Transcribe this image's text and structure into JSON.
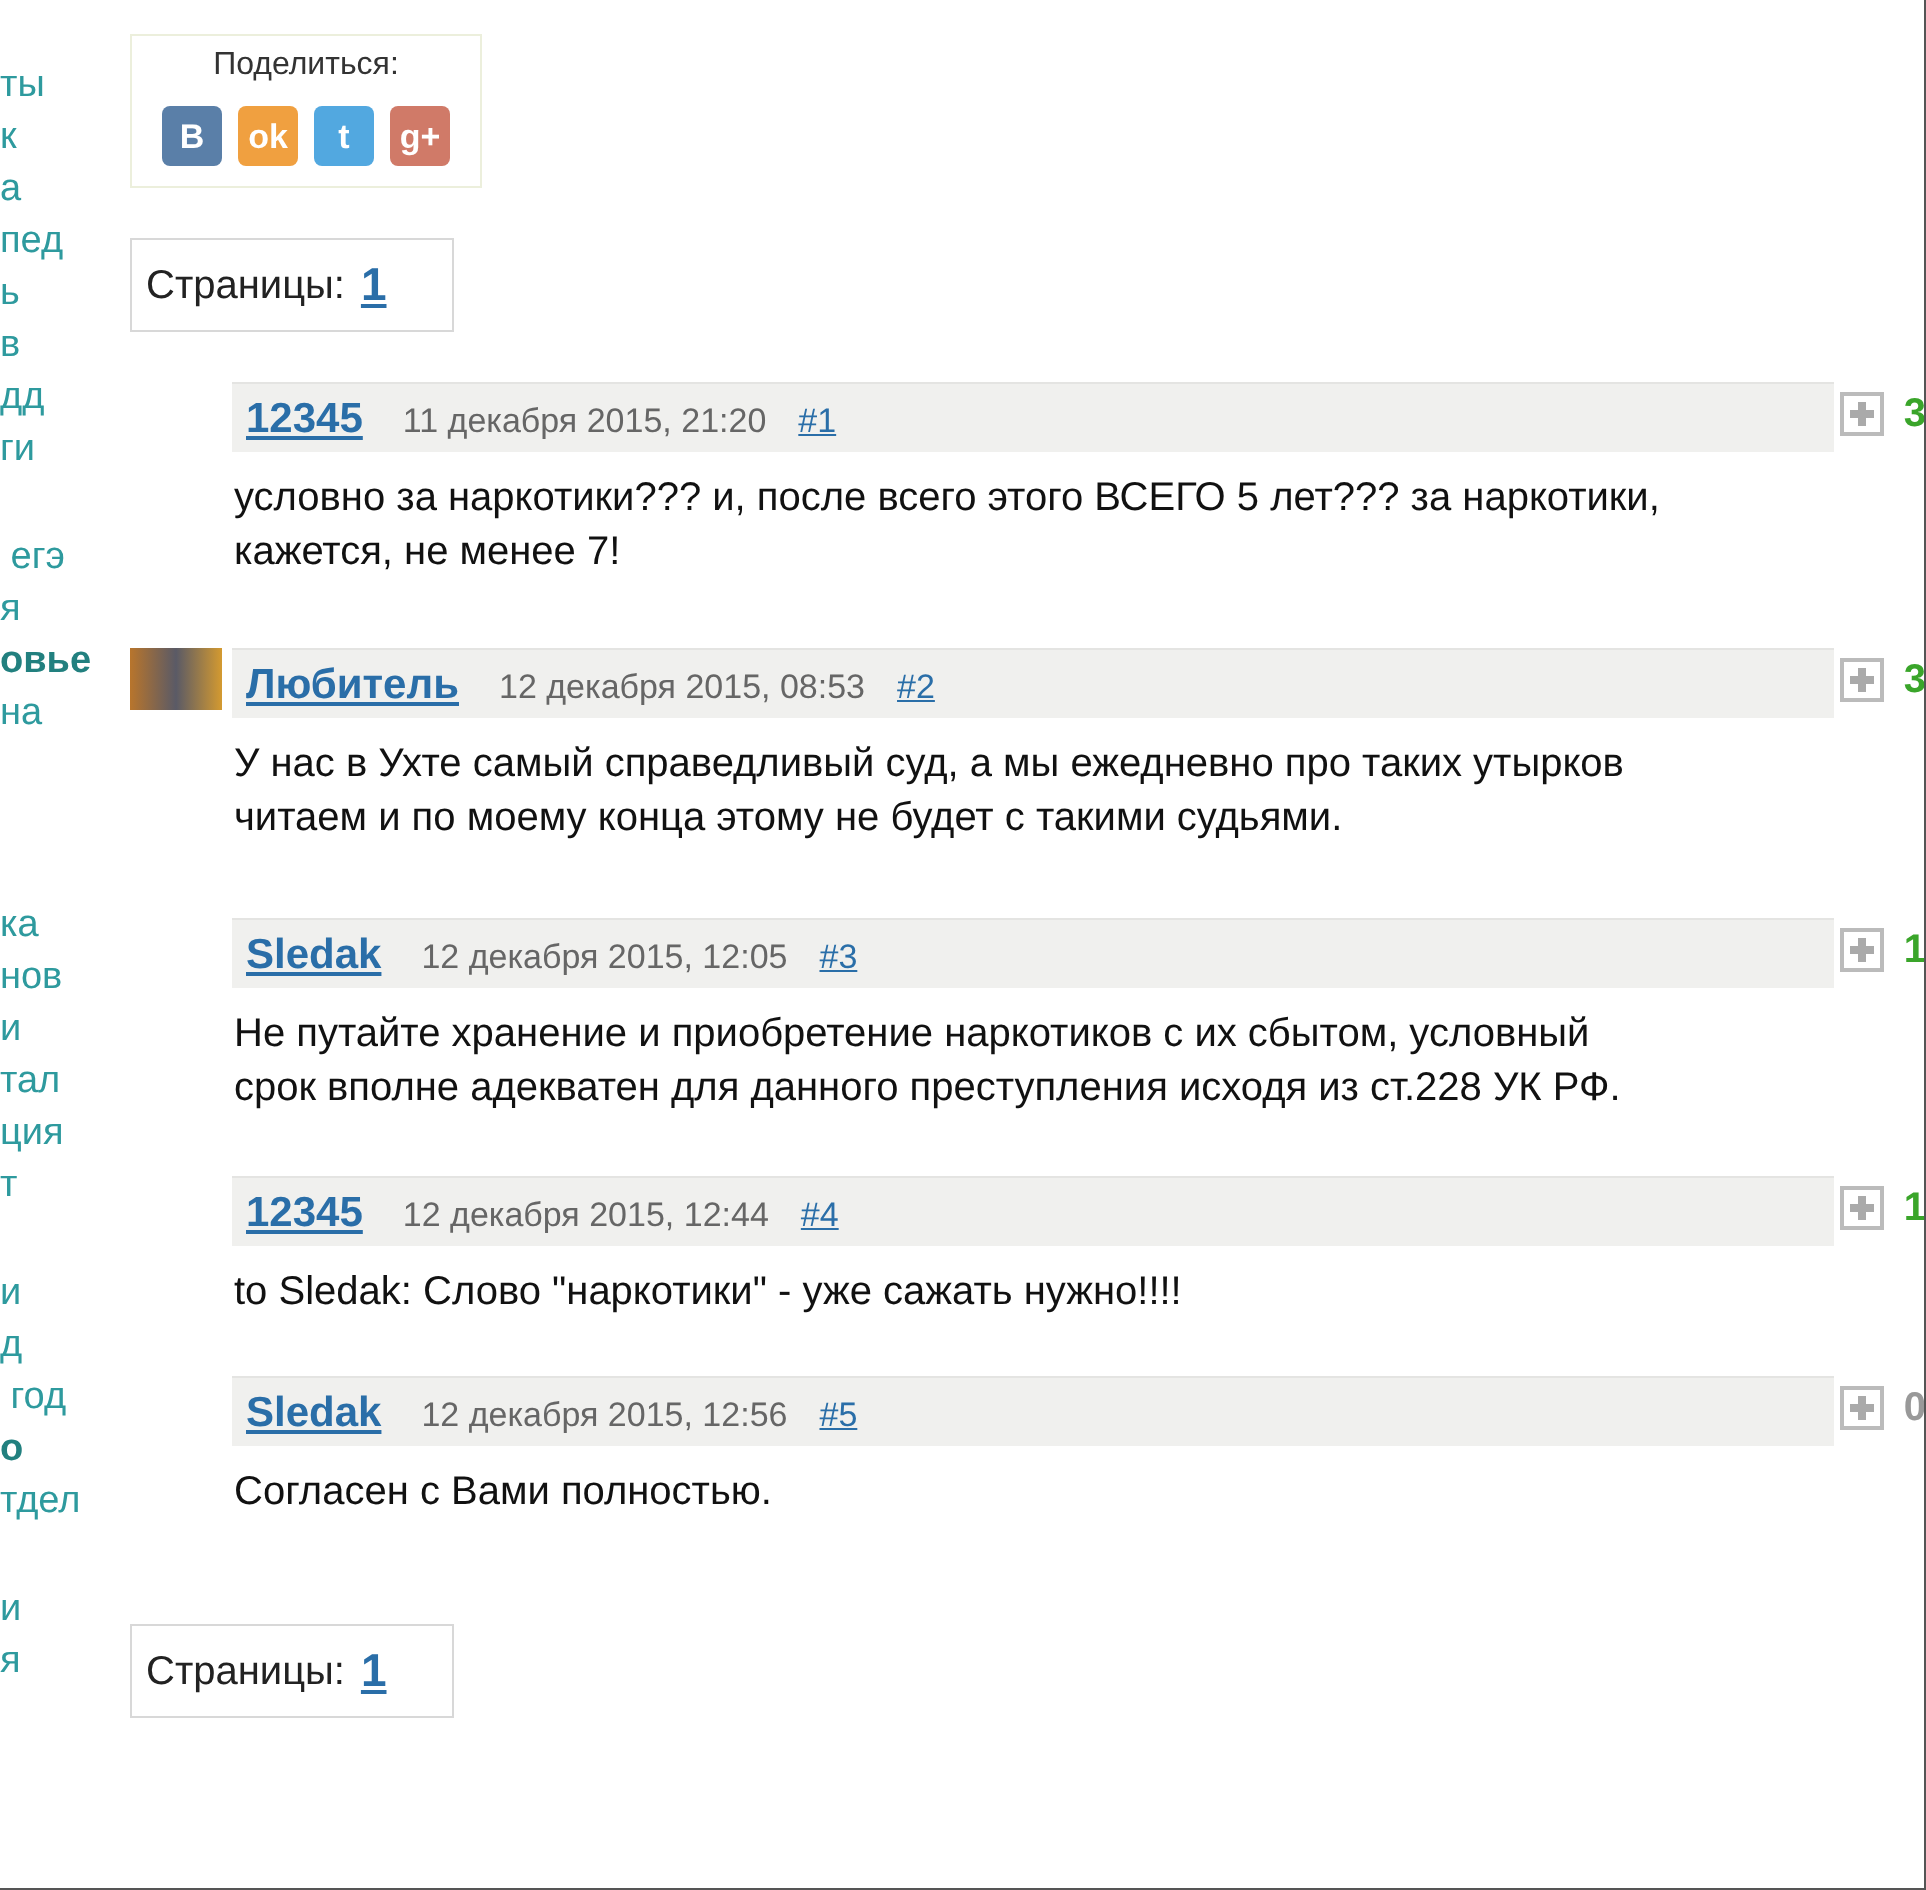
{
  "sidebar": {
    "groups": [
      {
        "items": [
          {
            "text": "ты",
            "bold": false
          },
          {
            "text": "к",
            "bold": false
          },
          {
            "text": "а",
            "bold": false
          },
          {
            "text": "пед",
            "bold": false
          },
          {
            "text": "ь",
            "bold": false
          },
          {
            "text": "в",
            "bold": false
          },
          {
            "text": "дд",
            "bold": false
          },
          {
            "text": "ги",
            "bold": false
          }
        ]
      },
      {
        "items": [
          {
            "text": " егэ",
            "bold": false
          },
          {
            "text": "я",
            "bold": false
          },
          {
            "text": "овье",
            "bold": true
          },
          {
            "text": "на",
            "bold": false
          }
        ]
      },
      {
        "items": [
          {
            "text": "ка",
            "bold": false
          },
          {
            "text": "нов",
            "bold": false
          },
          {
            "text": "и",
            "bold": false
          },
          {
            "text": "тал",
            "bold": false
          },
          {
            "text": "ция",
            "bold": false
          },
          {
            "text": "т",
            "bold": false
          }
        ]
      },
      {
        "items": [
          {
            "text": "и",
            "bold": false
          },
          {
            "text": "д",
            "bold": false
          },
          {
            "text": " год",
            "bold": false
          },
          {
            "text": "о",
            "bold": true
          },
          {
            "text": "тдел",
            "bold": false
          }
        ]
      },
      {
        "items": [
          {
            "text": "и",
            "bold": false
          },
          {
            "text": "я",
            "bold": false
          }
        ]
      }
    ]
  },
  "share": {
    "label": "Поделиться:",
    "buttons": [
      {
        "kind": "vk",
        "label": "В"
      },
      {
        "kind": "ok",
        "label": "ok"
      },
      {
        "kind": "twitter",
        "label": "t"
      },
      {
        "kind": "gplus",
        "label": "g+"
      }
    ]
  },
  "pages_top": {
    "label": "Страницы:",
    "pages": [
      "1"
    ]
  },
  "comments": [
    {
      "author": "12345",
      "avatar": false,
      "date": "11 декабря 2015, 21:20",
      "number": "#1",
      "text": "условно за наркотики??? и, после всего этого ВСЕГО 5 лет??? за наркотики, кажется, не менее 7!",
      "score": "3",
      "color": "#3aa52a"
    },
    {
      "author": "Любитель",
      "avatar": true,
      "date": "12 декабря 2015, 08:53",
      "number": "#2",
      "text": "У нас в Ухте самый справедливый суд, а мы ежедневно про таких утырков читаем и по моему конца этому не будет с такими судьями.",
      "score": "3",
      "color": "#3aa52a"
    },
    {
      "author": "Sledak",
      "avatar": false,
      "date": "12 декабря 2015, 12:05",
      "number": "#3",
      "text": "Не путайте хранение и приобретение наркотиков с их сбытом, условный срок вполне адекватен для данного преступления исходя из ст.228 УК РФ.",
      "score": "1",
      "color": "#3aa52a"
    },
    {
      "author": "12345",
      "avatar": false,
      "date": "12 декабря 2015, 12:44",
      "number": "#4",
      "text": "to Sledak: Слово \"наркотики\" - уже сажать нужно!!!!",
      "score": "1",
      "color": "#3aa52a"
    },
    {
      "author": "Sledak",
      "avatar": false,
      "date": "12 декабря 2015, 12:56",
      "number": "#5",
      "text": "Согласен с Вами полностью.",
      "score": "0",
      "color": "#999999"
    }
  ],
  "pages_bottom": {
    "label": "Страницы:",
    "pages": [
      "1"
    ]
  }
}
